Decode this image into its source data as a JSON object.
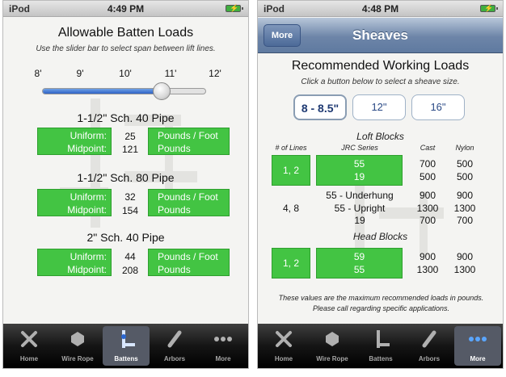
{
  "left": {
    "status": {
      "carrier": "iPod",
      "time": "4:49 PM"
    },
    "title": "Allowable Batten Loads",
    "subtitle": "Use the slider bar to select span between lift lines.",
    "spans": [
      "8'",
      "9'",
      "10'",
      "11'",
      "12'"
    ],
    "slider_value_feet": 11,
    "pipes": [
      {
        "name": "1-1/2\" Sch. 40 Pipe",
        "uniform_label": "Uniform:",
        "uniform": "25",
        "uniform_unit": "Pounds / Foot",
        "midpoint_label": "Midpoint:",
        "midpoint": "121",
        "midpoint_unit": "Pounds"
      },
      {
        "name": "1-1/2\" Sch. 80 Pipe",
        "uniform_label": "Uniform:",
        "uniform": "32",
        "uniform_unit": "Pounds / Foot",
        "midpoint_label": "Midpoint:",
        "midpoint": "154",
        "midpoint_unit": "Pounds"
      },
      {
        "name": "2\" Sch. 40 Pipe",
        "uniform_label": "Uniform:",
        "uniform": "44",
        "uniform_unit": "Pounds / Foot",
        "midpoint_label": "Midpoint:",
        "midpoint": "208",
        "midpoint_unit": "Pounds"
      }
    ],
    "tabs": [
      {
        "label": "Home",
        "icon": "hammer-wrench-icon"
      },
      {
        "label": "Wire Rope",
        "icon": "wire-rope-icon"
      },
      {
        "label": "Battens",
        "icon": "batten-icon",
        "active": true
      },
      {
        "label": "Arbors",
        "icon": "arbor-icon"
      },
      {
        "label": "More",
        "icon": "more-dots-icon"
      }
    ]
  },
  "right": {
    "status": {
      "carrier": "iPod",
      "time": "4:48 PM"
    },
    "nav": {
      "back_label": "More",
      "title": "Sheaves"
    },
    "title": "Recommended Working Loads",
    "subtitle": "Click a button below to select a sheave size.",
    "sheave_buttons": [
      {
        "label": "8 - 8.5\"",
        "selected": true
      },
      {
        "label": "12\"",
        "selected": false
      },
      {
        "label": "16\"",
        "selected": false
      }
    ],
    "loft_title": "Loft Blocks",
    "headers": {
      "lines": "# of Lines",
      "series": "JRC Series",
      "cast": "Cast",
      "nylon": "Nylon"
    },
    "loft_rows": [
      {
        "lines": "1, 2",
        "series": [
          "55",
          "19"
        ],
        "cast": [
          "700",
          "500"
        ],
        "nylon": [
          "500",
          "500"
        ],
        "highlight": true
      },
      {
        "lines": "4, 8",
        "series": [
          "55 - Underhung",
          "55 - Upright",
          "19"
        ],
        "cast": [
          "900",
          "1300",
          "700"
        ],
        "nylon": [
          "900",
          "1300",
          "700"
        ],
        "highlight": false
      }
    ],
    "head_title": "Head Blocks",
    "head_rows": [
      {
        "lines": "1, 2",
        "series": [
          "59",
          "55"
        ],
        "cast": [
          "900",
          "1300"
        ],
        "nylon": [
          "900",
          "1300"
        ],
        "highlight": true
      }
    ],
    "note": "These values are the maximum recommended loads in pounds.  Please call regarding specific applications.",
    "tabs": [
      {
        "label": "Home",
        "icon": "hammer-wrench-icon"
      },
      {
        "label": "Wire Rope",
        "icon": "wire-rope-icon"
      },
      {
        "label": "Battens",
        "icon": "batten-icon"
      },
      {
        "label": "Arbors",
        "icon": "arbor-icon"
      },
      {
        "label": "More",
        "icon": "more-dots-icon",
        "active": true
      }
    ]
  },
  "colors": {
    "green": "#43c443",
    "nav_blue": "#6d85a8",
    "slider_blue": "#2e63c6"
  }
}
